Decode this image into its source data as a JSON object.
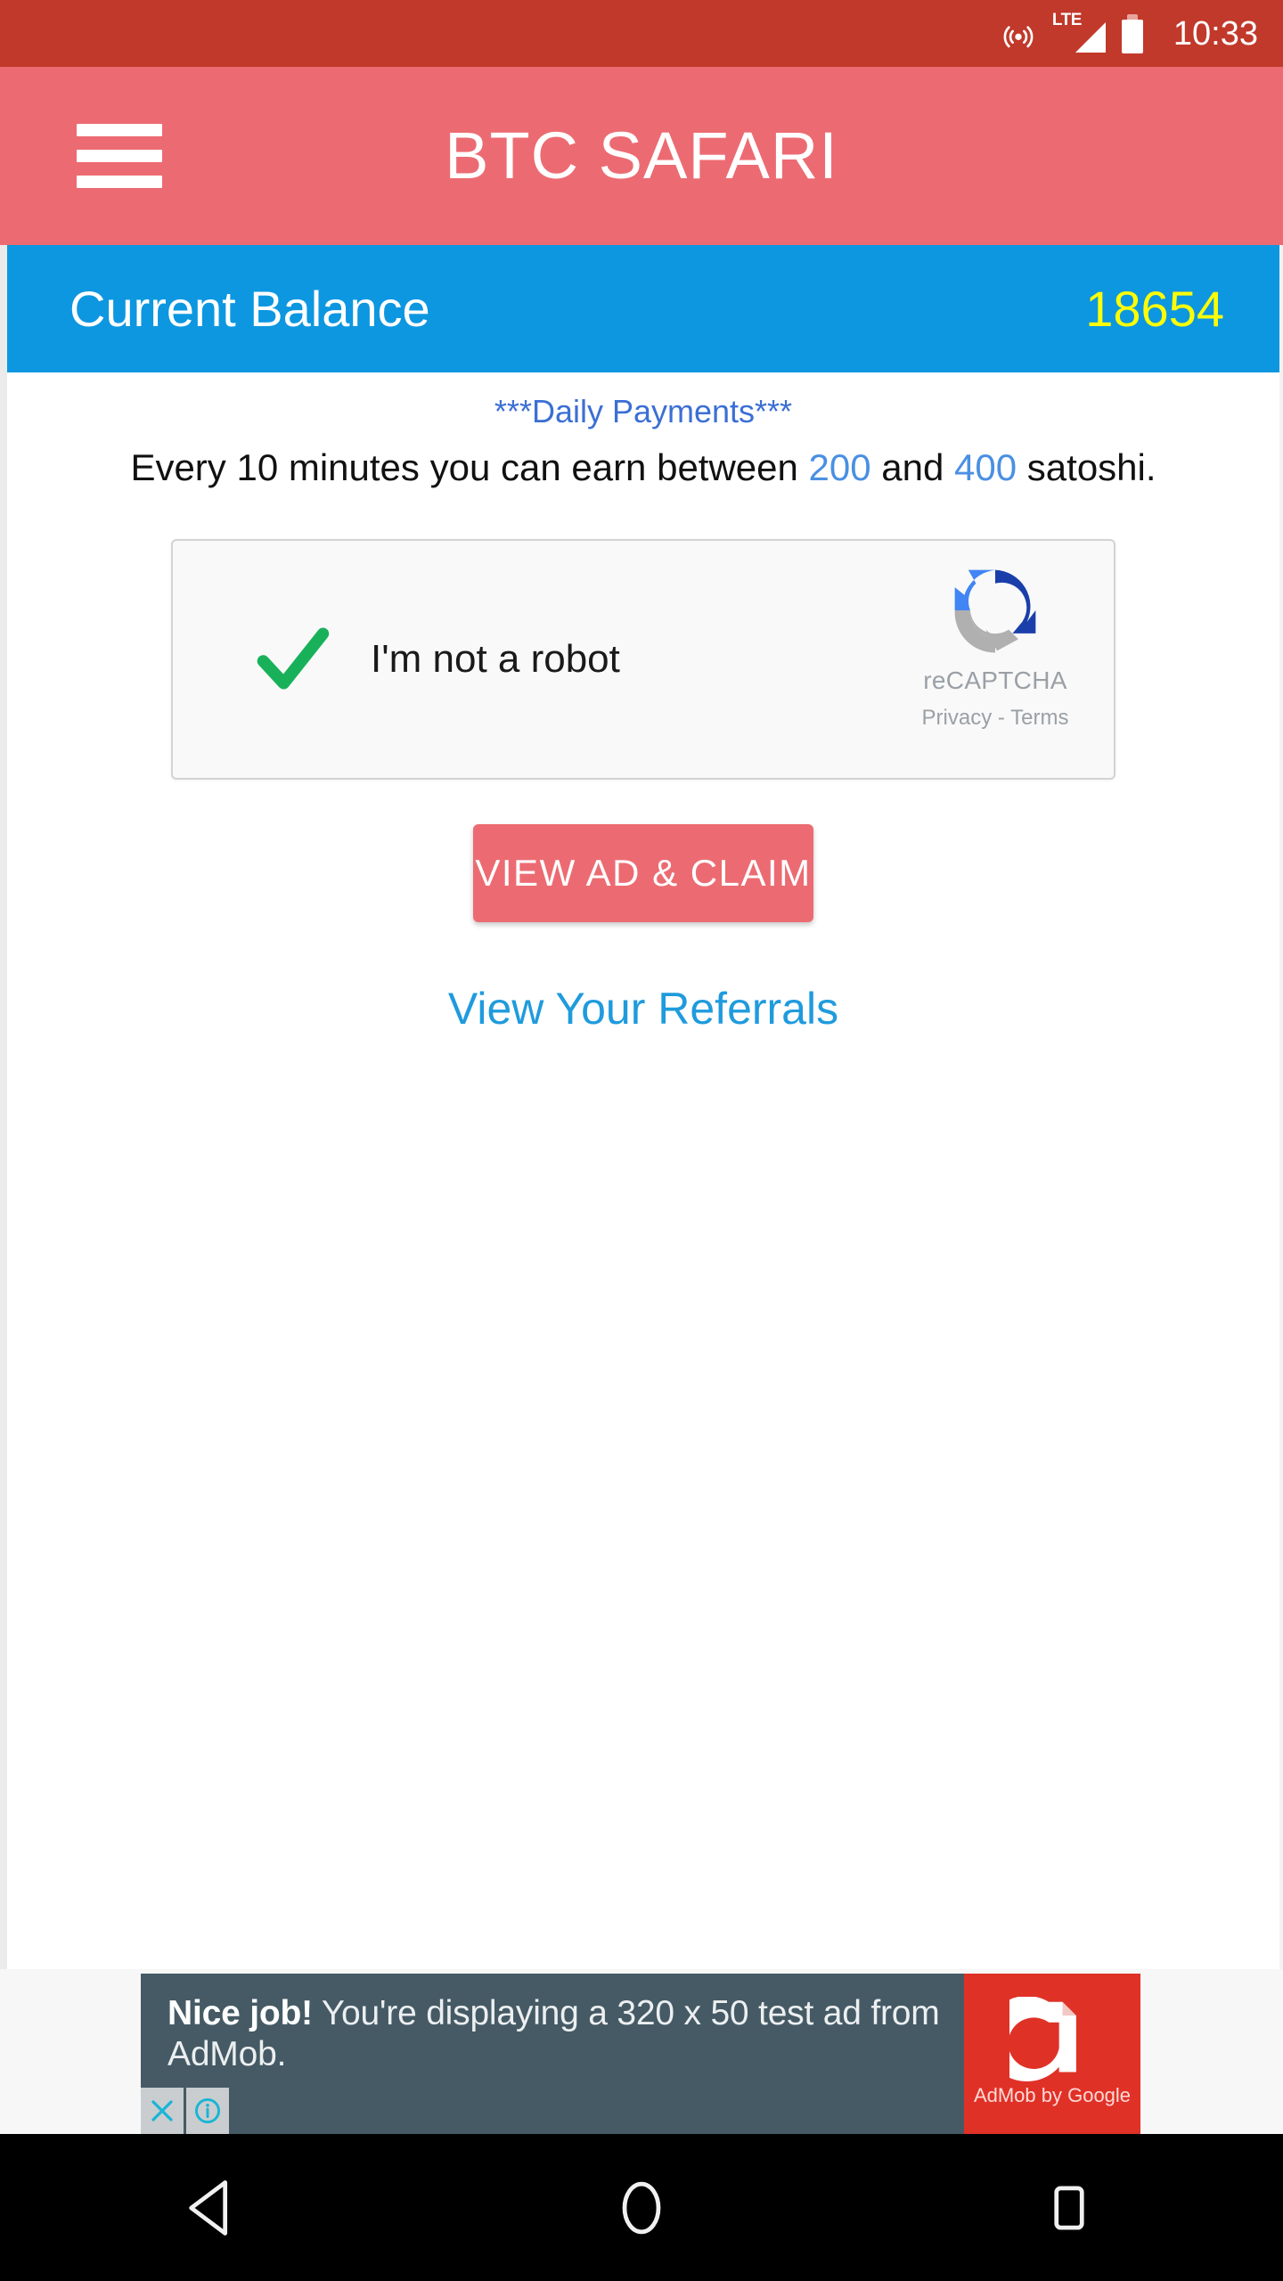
{
  "status_bar": {
    "hotspot_icon": "hotspot-icon",
    "network_type": "LTE",
    "signal_icon": "signal-bars-icon",
    "battery_icon": "battery-icon",
    "time": "10:33",
    "background_color": "#c1392b"
  },
  "app_bar": {
    "menu_icon": "hamburger-menu-icon",
    "title": "BTC SAFARI",
    "background_color": "#ec6b72"
  },
  "balance": {
    "label": "Current Balance",
    "value": "18654",
    "background_color": "#0d97e0",
    "value_color": "#fdfd07"
  },
  "info": {
    "daily_title": "***Daily Payments***",
    "earn_prefix": "Every 10 minutes you can earn between ",
    "earn_min": "200",
    "earn_middle": " and ",
    "earn_max": "400",
    "earn_suffix": " satoshi.",
    "link_color": "#4a90e2"
  },
  "recaptcha": {
    "checkbox_state": "checked",
    "check_icon": "green-check-icon",
    "label": "I'm not a robot",
    "logo_icon": "recaptcha-logo-icon",
    "brand_name": "reCAPTCHA",
    "terms": "Privacy - Terms"
  },
  "actions": {
    "claim_label": "VIEW AD & CLAIM",
    "claim_color": "#ec6b72",
    "referrals_label": "View Your Referrals",
    "referrals_color": "#1f9bdd"
  },
  "ad": {
    "headline": "Nice job!",
    "body": " You're displaying a 320 x 50 test ad from AdMob.",
    "close_icon": "close-x-icon",
    "info_icon": "info-circle-icon",
    "brand_icon": "admob-logo-icon",
    "brand_text": "AdMob by Google",
    "panel_color": "#455a64",
    "brand_color": "#e03127"
  },
  "navigation": {
    "back_icon": "back-triangle-icon",
    "home_icon": "home-circle-icon",
    "recents_icon": "recents-square-icon"
  }
}
